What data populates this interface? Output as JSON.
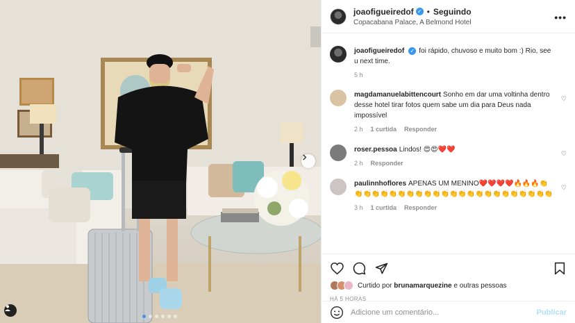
{
  "post": {
    "author": "joaofigueiredof",
    "follow_dot": "•",
    "follow_label": "Seguindo",
    "location": "Copacabana Palace, A Belmond Hotel",
    "more_label": "•••",
    "verified_glyph": "✓",
    "caption": "foi rápido, chuvoso e muito bom :) Rio, see u next time.",
    "caption_time": "5 h"
  },
  "comments": [
    {
      "user": "magdamanuelabittencourt",
      "text": "Sonho em dar uma voltinha dentro desse hotel tirar fotos quem sabe um dia para Deus nada impossível",
      "time": "2 h",
      "likes": "1 curtida",
      "reply": "Responder"
    },
    {
      "user": "roser.pessoa",
      "text": "Lindos! 😍😍❤️❤️",
      "time": "2 h",
      "likes": "",
      "reply": "Responder"
    },
    {
      "user": "paulinnhoflores",
      "text": "APENAS UM MENINO❤️❤️❤️❤️🔥🔥🔥👏👏👏👏👏👏👏👏👏👏👏👏👏👏👏👏👏👏👏👏👏👏👏👏",
      "time": "3 h",
      "likes": "1 curtida",
      "reply": "Responder"
    }
  ],
  "likes_summary": {
    "prefix": "Curtido por",
    "user": "brunamarquezine",
    "suffix": "e outras pessoas"
  },
  "timestamp": "HÁ 5 HORAS",
  "comment_input": {
    "placeholder": "Adicione um comentário...",
    "publish_label": "Publicar"
  },
  "carousel": {
    "count": 6,
    "active": 0
  },
  "colors": {
    "verified": "#3897f0",
    "publish_disabled": "#b2dffc",
    "carousel_active": "#4a90e2"
  },
  "icons": [
    "heart-icon",
    "comment-icon",
    "share-icon",
    "bookmark-icon",
    "smile-icon",
    "chevron-right-icon",
    "user-tag-icon"
  ]
}
